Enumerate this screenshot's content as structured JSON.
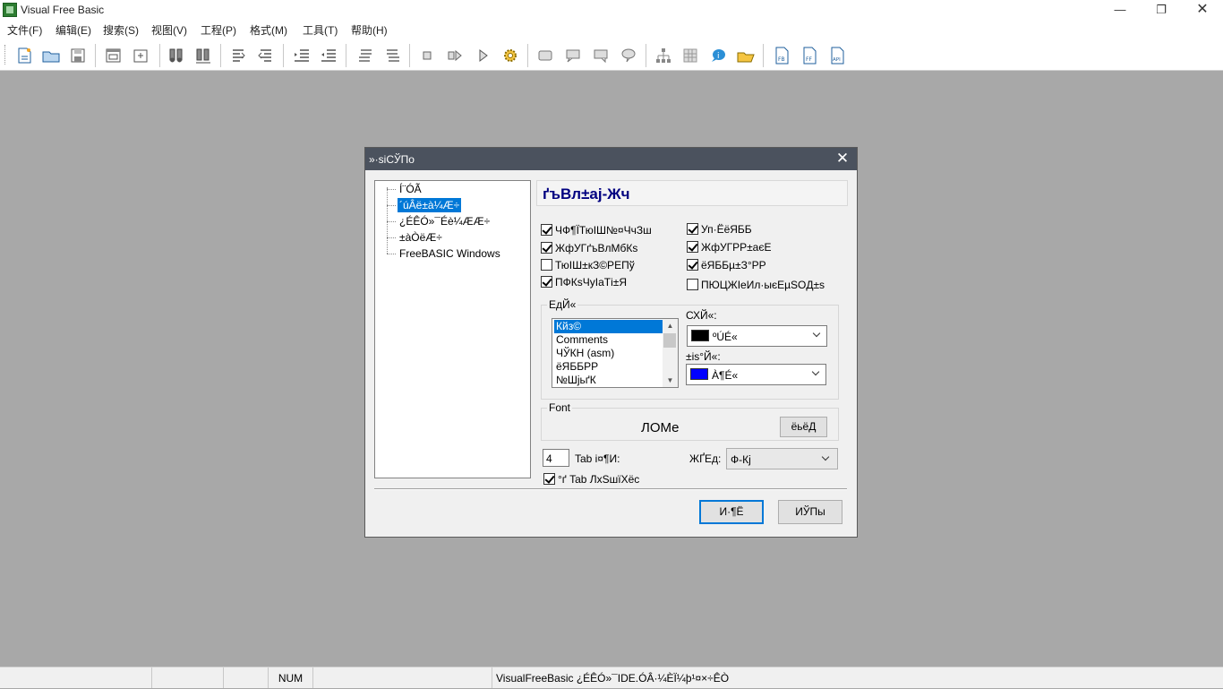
{
  "window": {
    "title": "Visual Free Basic"
  },
  "menu": [
    "文件(F)",
    "编辑(E)",
    "搜索(S)",
    "视图(V)",
    "工程(P)",
    "格式(M)",
    "工具(T)",
    "帮助(H)"
  ],
  "dialog": {
    "title": "»·siСЎПо",
    "tree": [
      {
        "label": "Í¨ÓÃ",
        "selected": false
      },
      {
        "label": "´úÂë±à¼­Æ÷",
        "selected": true
      },
      {
        "label": "¿ÉÊÓ»¯Éè¼ÆÆ÷",
        "selected": false
      },
      {
        "label": "±àÒëÆ÷",
        "selected": false
      },
      {
        "label": "FreeBASIC Windows",
        "selected": false
      }
    ],
    "section_title": "ґъВл±аj-Жч",
    "checks_left": [
      {
        "label": "ЧФ¶ЇТюІШ№¤ЧчЗш",
        "checked": true
      },
      {
        "label": "ЖфУГґъВлМбКѕ",
        "checked": true
      },
      {
        "label": "ТюІШ±кЗ©РЕПў",
        "checked": false
      },
      {
        "label": "ПФКѕЧуІаТі±Я",
        "checked": true
      }
    ],
    "checks_right": [
      {
        "label": "Уп·ЁёЯББ",
        "checked": true
      },
      {
        "label": "ЖфУГРР±аєЕ",
        "checked": true
      },
      {
        "label": "ёЯББµ±З°РР",
        "checked": true
      },
      {
        "label": "ПЮЦЖІеИл·ыєЕµSOД±s",
        "checked": false
      }
    ],
    "elements_group_label": "ЕдЙ«",
    "elements_list": [
      "Кйз©",
      "Comments",
      "ЧЎКН (asm)",
      "ёЯББРР",
      "№ШјьґК"
    ],
    "foreground_label": "СХЙ«:",
    "foreground_value": "ºÚÉ«",
    "foreground_color": "#000000",
    "background_label": "±іѕ°Й«:",
    "background_value": "À¶É«",
    "background_color": "#0000ff",
    "font_group_label": "Font",
    "font_name": "ЛОМе",
    "font_button": "ёьёД",
    "tab_size": "4",
    "tab_size_label": "Tab і¤¶И:",
    "tab_spaces_label": "°ґ Tab ЛхЅшїХёс",
    "tab_spaces_checked": true,
    "case_label": "ЖҐЕд:",
    "case_value": "Ф-Кј",
    "ok_button": "И·¶Ё",
    "cancel_button": "ИЎПы"
  },
  "statusbar": {
    "num": "NUM",
    "message": "VisualFreeBasic ¿ÉÊÓ»¯IDE.ÓÂ·¼ÈÏ¼þ¹¤×÷ÊÒ"
  }
}
